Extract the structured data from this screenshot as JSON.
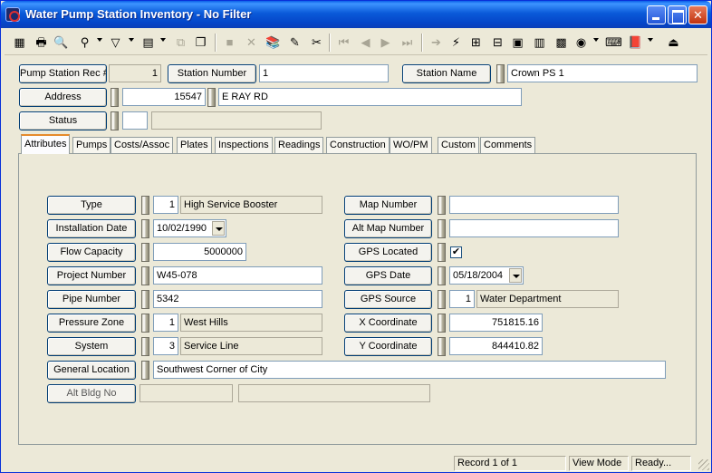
{
  "window": {
    "title": "Water Pump Station Inventory - No Filter"
  },
  "header": {
    "rec_label": "Pump Station Rec #",
    "rec_value": "1",
    "station_number_label": "Station Number",
    "station_number_value": "1",
    "station_name_label": "Station Name",
    "station_name_value": "Crown PS 1",
    "address_label": "Address",
    "address_number": "15547",
    "address_street": "E RAY RD",
    "status_label": "Status",
    "status_code": "",
    "status_desc": ""
  },
  "tabs": [
    "Attributes",
    "Pumps",
    "Costs/Assoc",
    "Plates",
    "Inspections",
    "Readings",
    "Construction",
    "WO/PM",
    "Custom",
    "Comments"
  ],
  "active_tab": "Attributes",
  "attributes": {
    "type_label": "Type",
    "type_code": "1",
    "type_desc": "High Service Booster",
    "install_label": "Installation Date",
    "install_value": "10/02/1990",
    "flow_label": "Flow Capacity",
    "flow_value": "5000000",
    "project_label": "Project Number",
    "project_value": "W45-078",
    "pipe_label": "Pipe Number",
    "pipe_value": "5342",
    "pressure_label": "Pressure Zone",
    "pressure_code": "1",
    "pressure_desc": "West Hills",
    "system_label": "System",
    "system_code": "3",
    "system_desc": "Service Line",
    "genloc_label": "General Location",
    "genloc_value": "Southwest Corner of City",
    "altbldg_label": "Alt Bldg No",
    "altbldg_value1": "",
    "altbldg_value2": "",
    "map_label": "Map Number",
    "map_value": "",
    "altmap_label": "Alt Map Number",
    "altmap_value": "",
    "gps_located_label": "GPS Located",
    "gps_located_checked": true,
    "gps_date_label": "GPS Date",
    "gps_date_value": "05/18/2004",
    "gps_source_label": "GPS Source",
    "gps_source_code": "1",
    "gps_source_desc": "Water Department",
    "x_label": "X Coordinate",
    "x_value": "751815.16",
    "y_label": "Y Coordinate",
    "y_value": "844410.82"
  },
  "statusbar": {
    "record": "Record 1 of 1",
    "mode": "View Mode",
    "state": "Ready..."
  },
  "colors": {
    "title_bar": "#0a5ad9",
    "tab_highlight": "#e68b2c",
    "window_bg": "#ece9d8"
  }
}
